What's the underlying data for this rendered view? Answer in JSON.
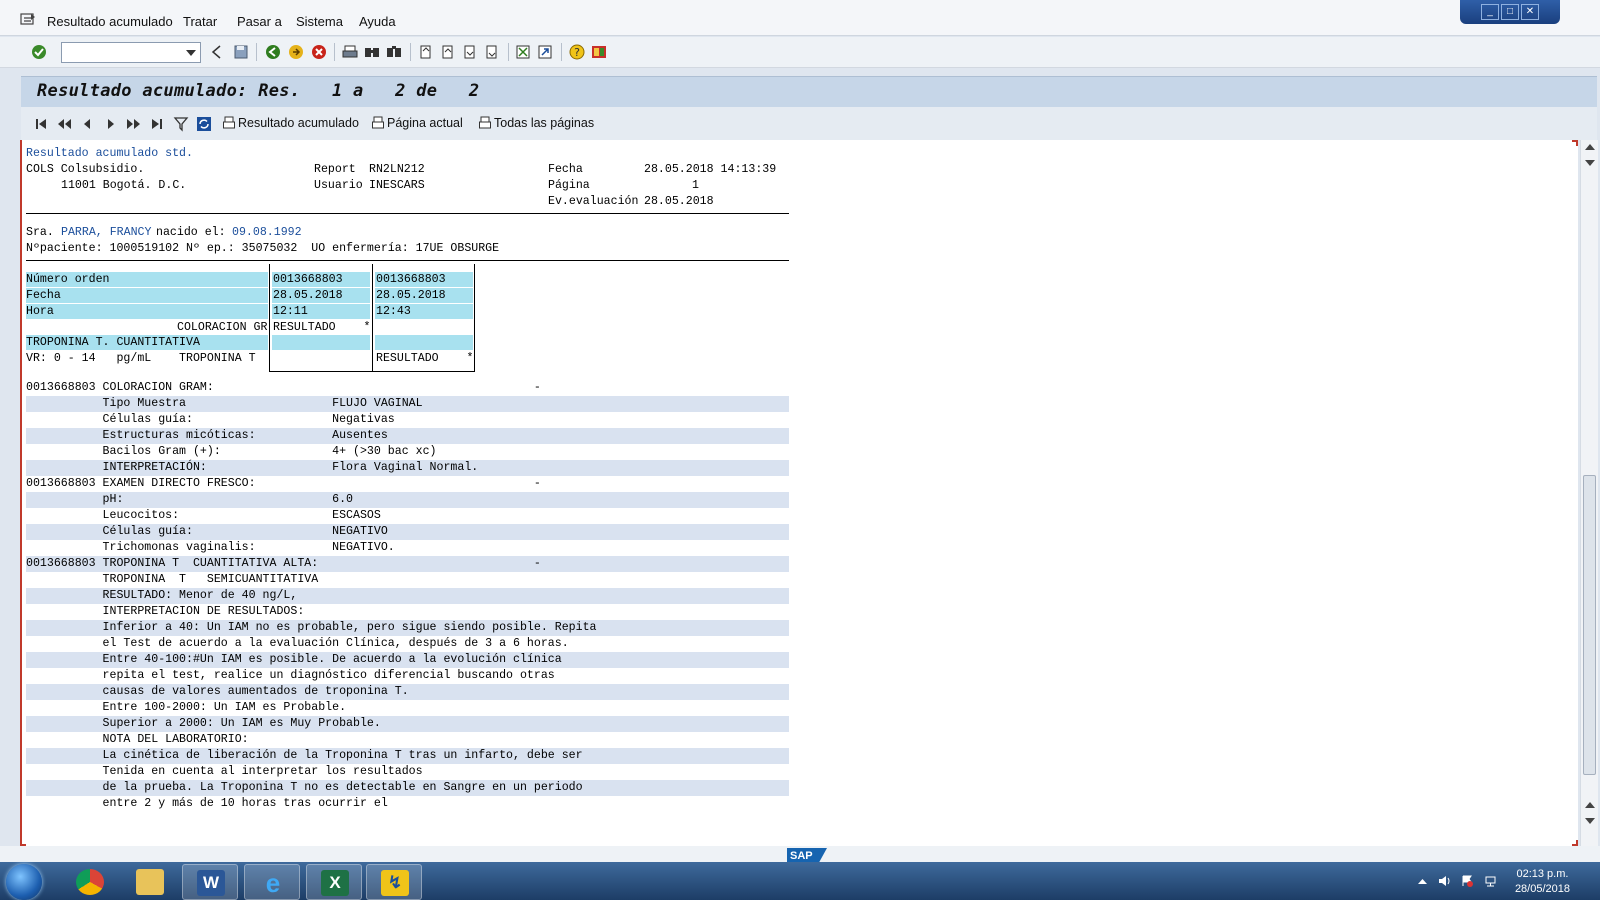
{
  "menu": {
    "items": [
      {
        "label": "Resultado acumulado",
        "name": "menu-resultado-acumulado"
      },
      {
        "label": "Tratar",
        "name": "menu-tratar"
      },
      {
        "label": "Pasar a",
        "name": "menu-pasar-a"
      },
      {
        "label": "Sistema",
        "name": "menu-sistema"
      },
      {
        "label": "Ayuda",
        "name": "menu-ayuda"
      }
    ]
  },
  "toolbar": {
    "command_value": ""
  },
  "title": "Resultado acumulado: Res.   1 a   2 de   2",
  "app_toolbar": {
    "btn_cumulative": "Resultado acumulado",
    "btn_current_page": "Página actual",
    "btn_all_pages": "Todas las páginas"
  },
  "report": {
    "heading": "Resultado acumulado std.",
    "org": "COLS Colsubsidio.",
    "city": "11001 Bogotá. D.C.",
    "report_label": "Report",
    "report_value": "RN2LN212",
    "user_label": "Usuario",
    "user_value": "INESCARS",
    "fecha_label": "Fecha",
    "fecha_value": "28.05.2018 14:13:39",
    "pagina_label": "Página",
    "pagina_value": "1",
    "eval_label": "Ev.evaluación",
    "eval_value": "28.05.2018"
  },
  "patient": {
    "salutation": "Sra.",
    "name": "PARRA, FRANCY",
    "born_label": "nacido el:",
    "born_value": "09.08.1992",
    "line2": "Nºpaciente: 1000519102 Nº ep.: 35075032  UO enfermería: 17UE OBSURGE"
  },
  "grid": {
    "labels": [
      "Número orden",
      "Fecha",
      "Hora"
    ],
    "row4_label": "COLORACION GR",
    "row5_label": "TROPONINA T. CUANTITATIVA",
    "row6_label": "VR: 0 - 14   pg/mL    TROPONINA T",
    "col1": {
      "orden": "0013668803",
      "fecha": "28.05.2018",
      "hora": "12:11",
      "r4": "RESULTADO    *",
      "r6": ""
    },
    "col2": {
      "orden": "0013668803",
      "fecha": "28.05.2018",
      "hora": "12:43",
      "r4": "",
      "r6": "RESULTADO    *"
    }
  },
  "results": [
    "0013668803 COLORACION GRAM:                                              -",
    "           Tipo Muestra                     FLUJO VAGINAL",
    "           Células guía:                    Negativas",
    "           Estructuras micóticas:           Ausentes",
    "           Bacilos Gram (+):                4+ (>30 bac xc)",
    "           INTERPRETACIÓN:                  Flora Vaginal Normal.",
    "0013668803 EXAMEN DIRECTO FRESCO:                                        -",
    "           pH:                              6.0",
    "           Leucocitos:                      ESCASOS",
    "           Células guía:                    NEGATIVO",
    "           Trichomonas vaginalis:           NEGATIVO.",
    "0013668803 TROPONINA T  CUANTITATIVA ALTA:                               -",
    "           TROPONINA  T   SEMICUANTITATIVA",
    "           RESULTADO: Menor de 40 ng/L,",
    "           INTERPRETACION DE RESULTADOS:",
    "           Inferior a 40: Un IAM no es probable, pero sigue siendo posible. Repita",
    "           el Test de acuerdo a la evaluación Clínica, después de 3 a 6 horas.",
    "           Entre 40-100:#Un IAM es posible. De acuerdo a la evolución clínica",
    "           repita el test, realice un diagnóstico diferencial buscando otras",
    "           causas de valores aumentados de troponina T.",
    "           Entre 100-2000: Un IAM es Probable.",
    "           Superior a 2000: Un IAM es Muy Probable.",
    "           NOTA DEL LABORATORIO:",
    "           La cinética de liberación de la Troponina T tras un infarto, debe ser",
    "           Tenida en cuenta al interpretar los resultados",
    "           de la prueba. La Troponina T no es detectable en Sangre en un periodo",
    "           entre 2 y más de 10 horas tras ocurrir el"
  ],
  "sap_logo": "SAP",
  "taskbar": {
    "time": "02:13 p.m.",
    "date": "28/05/2018"
  },
  "colors": {
    "accent": "#1b4e9b",
    "cyan": "#a8e1ef",
    "alt_row": "#d9e2f0"
  }
}
